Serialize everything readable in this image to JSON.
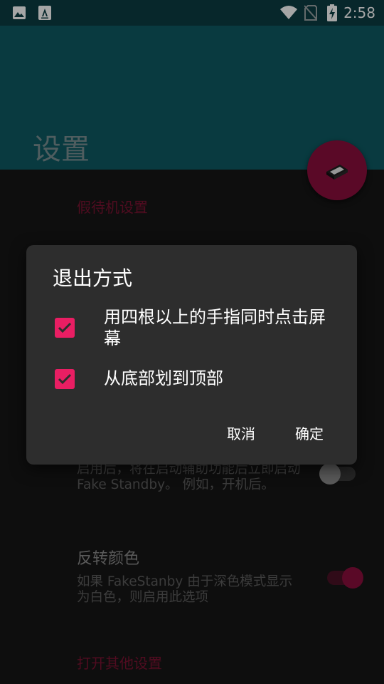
{
  "status_bar": {
    "time": "2:58",
    "left_icons": [
      "image-icon",
      "font-icon"
    ],
    "right_icons": [
      "wifi-icon",
      "no-sim-icon",
      "battery-charging-icon"
    ]
  },
  "app_bar": {
    "title": "设置"
  },
  "fab": {
    "icon": "device-icon"
  },
  "settings": {
    "section_fake_standby": "假待机设置",
    "auto_start": {
      "summary": "启用后，将在启动辅助功能后立即启动Fake Standby。 例如，开机后。",
      "enabled": false
    },
    "invert_colors": {
      "title": "反转颜色",
      "summary": "如果 FakeStanby 由于深色模式显示为白色，则启用此选项",
      "enabled": true
    },
    "section_other": "打开其他设置"
  },
  "dialog": {
    "title": "退出方式",
    "options": [
      {
        "label": "用四根以上的手指同时点击屏幕",
        "checked": true
      },
      {
        "label": "从底部划到顶部",
        "checked": true
      }
    ],
    "cancel_label": "取消",
    "confirm_label": "确定"
  },
  "colors": {
    "app_bar": "#0e5a63",
    "status_bar": "#0b3c42",
    "accent": "#e91e63",
    "fab": "#8a0f3c",
    "dialog_bg": "#2d2d2d",
    "screen_bg": "#161616"
  }
}
